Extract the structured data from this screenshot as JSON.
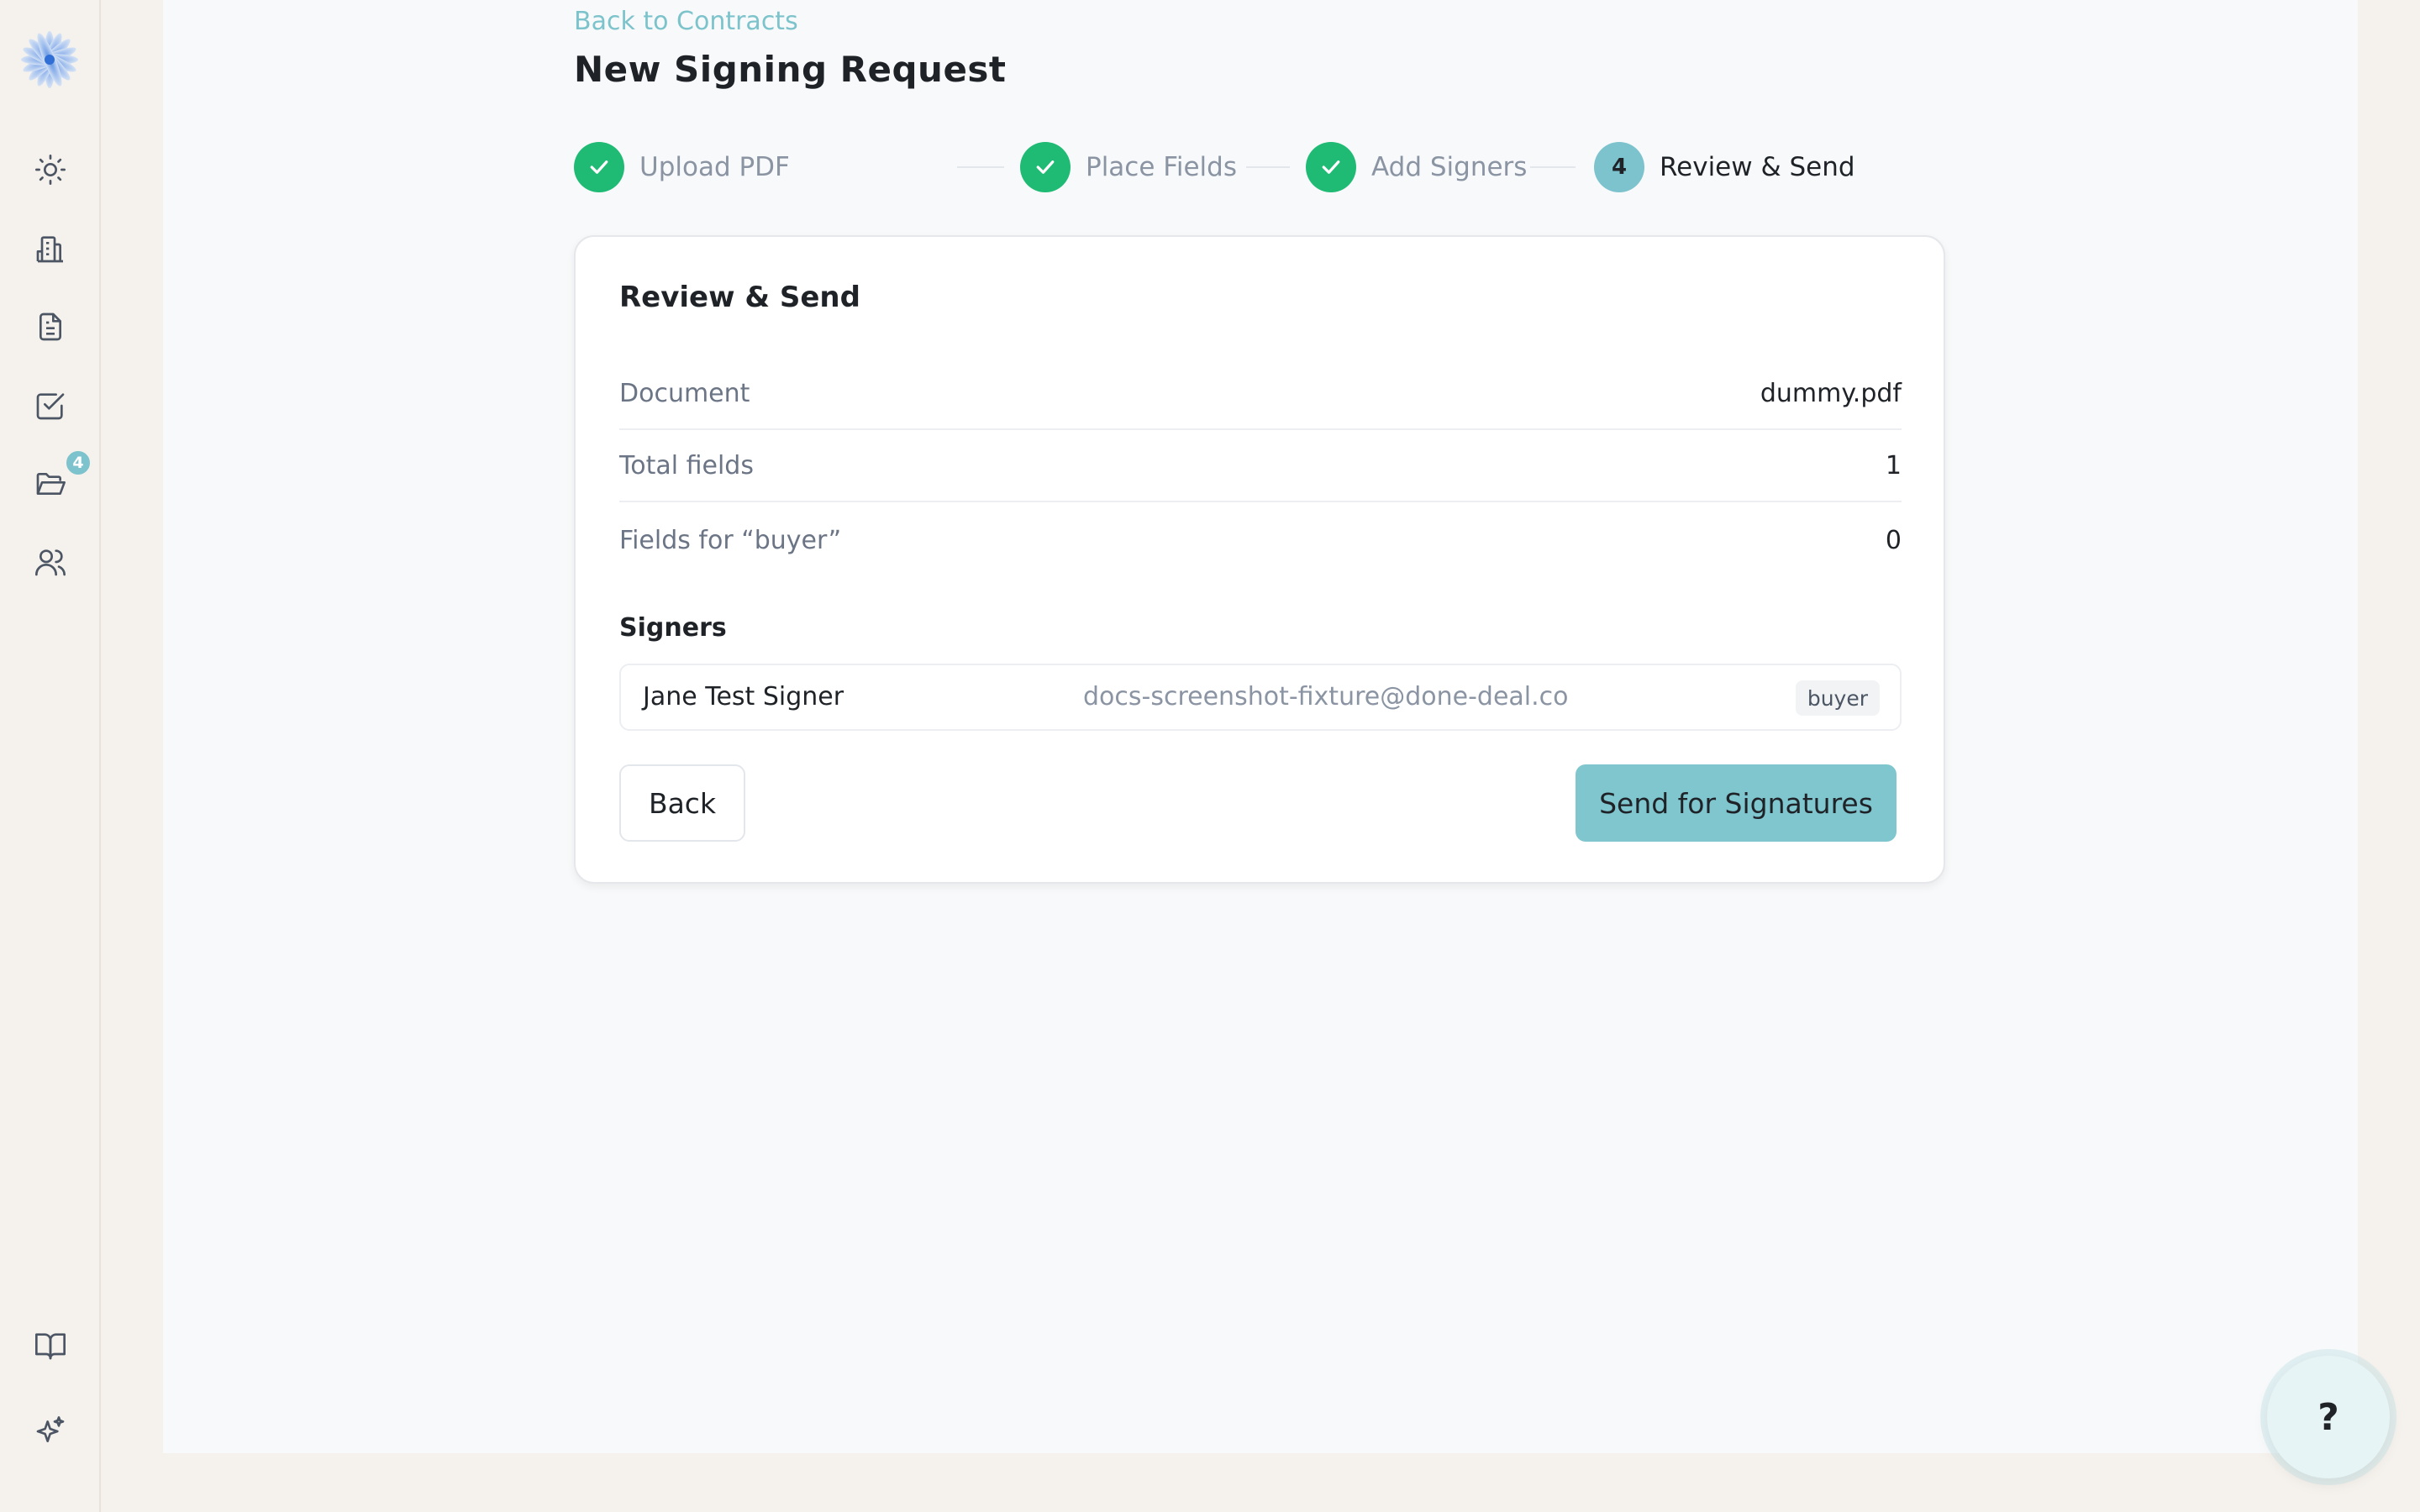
{
  "sidebar": {
    "items": [
      {
        "name": "dashboard",
        "icon": "sun-icon"
      },
      {
        "name": "properties",
        "icon": "building-icon"
      },
      {
        "name": "documents",
        "icon": "document-icon"
      },
      {
        "name": "tasks",
        "icon": "checkbox-icon"
      },
      {
        "name": "contracts",
        "icon": "folder-icon",
        "badge": "4"
      },
      {
        "name": "contacts",
        "icon": "users-icon"
      }
    ],
    "bottom": [
      {
        "name": "guides",
        "icon": "book-icon"
      },
      {
        "name": "ai-assistant",
        "icon": "sparkles-icon"
      }
    ]
  },
  "header": {
    "back_link": "Back to Contracts",
    "title": "New Signing Request"
  },
  "stepper": {
    "steps": [
      {
        "label": "Upload PDF",
        "state": "done"
      },
      {
        "label": "Place Fields",
        "state": "done"
      },
      {
        "label": "Add Signers",
        "state": "done"
      },
      {
        "label": "Review & Send",
        "state": "active",
        "number": "4"
      }
    ]
  },
  "review": {
    "title": "Review & Send",
    "rows": [
      {
        "label": "Document",
        "value": "dummy.pdf"
      },
      {
        "label": "Total fields",
        "value": "1"
      },
      {
        "label": "Fields for “buyer”",
        "value": "0"
      }
    ],
    "signers_heading": "Signers",
    "signers": [
      {
        "name": "Jane Test Signer",
        "email": "docs-screenshot-fixture@done-deal.co",
        "role": "buyer"
      }
    ],
    "back_label": "Back",
    "send_label": "Send for Signatures"
  },
  "help": {
    "label": "?"
  },
  "colors": {
    "accent": "#7dc3cd",
    "success": "#1fbb74",
    "sidebar_bg": "#f5f1ec",
    "main_bg": "#f8f9fa"
  }
}
